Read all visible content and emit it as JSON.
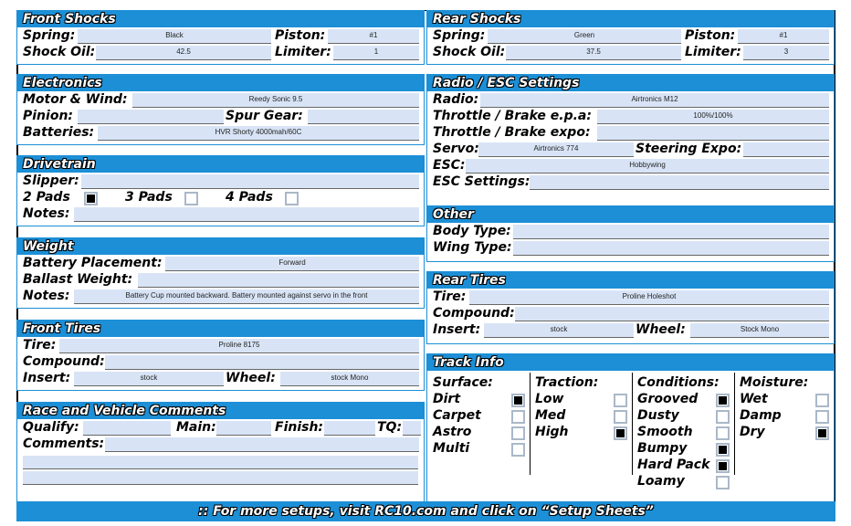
{
  "front_shocks": {
    "title": "Front Shocks",
    "spring_label": "Spring:",
    "spring": "Black",
    "piston_label": "Piston:",
    "piston": "#1",
    "oil_label": "Shock Oil:",
    "oil": "42.5",
    "limiter_label": "Limiter:",
    "limiter": "1"
  },
  "rear_shocks": {
    "title": "Rear Shocks",
    "spring_label": "Spring:",
    "spring": "Green",
    "piston_label": "Piston:",
    "piston": "#1",
    "oil_label": "Shock Oil:",
    "oil": "37.5",
    "limiter_label": "Limiter:",
    "limiter": "3"
  },
  "electronics": {
    "title": "Electronics",
    "motor_label": "Motor & Wind:",
    "motor": "Reedy Sonic 9.5",
    "pinion_label": "Pinion:",
    "pinion": "",
    "spur_label": "Spur Gear:",
    "spur": "",
    "batteries_label": "Batteries:",
    "batteries": "HVR Shorty 4000mah/60C"
  },
  "radio": {
    "title": "Radio / ESC Settings",
    "radio_label": "Radio:",
    "radio": "Airtronics M12",
    "epa_label": "Throttle / Brake e.p.a:",
    "epa": "100%/100%",
    "expo_label": "Throttle / Brake expo:",
    "expo": "",
    "servo_label": "Servo:",
    "servo": "Airtronics 774",
    "steer_label": "Steering Expo:",
    "steer": "",
    "esc_label": "ESC:",
    "esc": "Hobbywing",
    "settings_label": "ESC Settings:",
    "settings": ""
  },
  "drivetrain": {
    "title": "Drivetrain",
    "slipper_label": "Slipper:",
    "slipper": "",
    "pads2": "2 Pads",
    "pads3": "3 Pads",
    "pads4": "4 Pads",
    "pads2_on": true,
    "pads3_on": false,
    "pads4_on": false,
    "notes_label": "Notes:",
    "notes": ""
  },
  "other": {
    "title": "Other",
    "body_label": "Body Type:",
    "body": "",
    "wing_label": "Wing Type:",
    "wing": ""
  },
  "weight": {
    "title": "Weight",
    "placement_label": "Battery Placement:",
    "placement": "Forward",
    "ballast_label": "Ballast Weight:",
    "ballast": "",
    "notes_label": "Notes:",
    "notes": "Battery Cup mounted backward. Battery mounted against servo in the front"
  },
  "rear_tires": {
    "title": "Rear Tires",
    "tire_label": "Tire:",
    "tire": "Proline Holeshot",
    "compound_label": "Compound:",
    "compound": "",
    "insert_label": "Insert:",
    "insert": "stock",
    "wheel_label": "Wheel:",
    "wheel": "Stock Mono"
  },
  "front_tires": {
    "title": "Front Tires",
    "tire_label": "Tire:",
    "tire": "Proline 8175",
    "compound_label": "Compound:",
    "compound": "",
    "insert_label": "Insert:",
    "insert": "stock",
    "wheel_label": "Wheel:",
    "wheel": "stock Mono"
  },
  "comments": {
    "title": "Race and Vehicle Comments",
    "qualify_label": "Qualify:",
    "main_label": "Main:",
    "finish_label": "Finish:",
    "tq_label": "TQ:",
    "comments_label": "Comments:"
  },
  "track": {
    "title": "Track Info",
    "surface": {
      "title": "Surface:",
      "items": [
        [
          "Dirt",
          true
        ],
        [
          "Carpet",
          false
        ],
        [
          "Astro",
          false
        ],
        [
          "Multi",
          false
        ]
      ]
    },
    "traction": {
      "title": "Traction:",
      "items": [
        [
          "Low",
          false
        ],
        [
          "Med",
          false
        ],
        [
          "High",
          true
        ]
      ]
    },
    "conditions": {
      "title": "Conditions:",
      "items": [
        [
          "Grooved",
          true
        ],
        [
          "Dusty",
          false
        ],
        [
          "Smooth",
          false
        ],
        [
          "Bumpy",
          true
        ],
        [
          "Hard Pack",
          true
        ],
        [
          "Loamy",
          false
        ]
      ]
    },
    "moisture": {
      "title": "Moisture:",
      "items": [
        [
          "Wet",
          false
        ],
        [
          "Damp",
          false
        ],
        [
          "Dry",
          true
        ]
      ]
    }
  },
  "footer": ":: For more setups, visit RC10.com and click on “Setup Sheets”",
  "colors": {
    "accent": "#1c8fd6",
    "field": "#d8e4f6"
  }
}
